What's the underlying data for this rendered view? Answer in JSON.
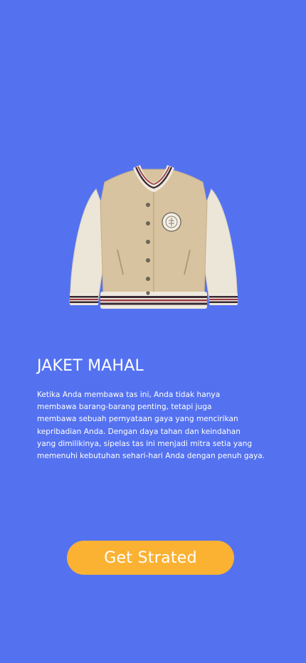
{
  "product": {
    "image_icon": "varsity-jacket-image",
    "title": "JAKET MAHAL",
    "description_lines": [
      "Ketika Anda membawa tas ini, Anda tidak hanya",
      "membawa barang-barang penting, tetapi juga",
      "membawa sebuah pernyataan gaya yang mencirikan",
      "kepribadian Anda. Dengan daya tahan dan keindahan",
      "yang dimilikinya, sipelas tas ini menjadi mitra setia yang",
      "memenuhi kebutuhan sehari-hari Anda dengan penuh gaya."
    ]
  },
  "cta": {
    "label": "Get Strated"
  },
  "colors": {
    "background": "#5472f0",
    "button": "#fbb232",
    "text": "#ffffff",
    "jacket_body": "#d8c3a0",
    "jacket_sleeves": "#ece6d8",
    "stripe_dark": "#3a2a35",
    "stripe_red": "#9a3540"
  }
}
